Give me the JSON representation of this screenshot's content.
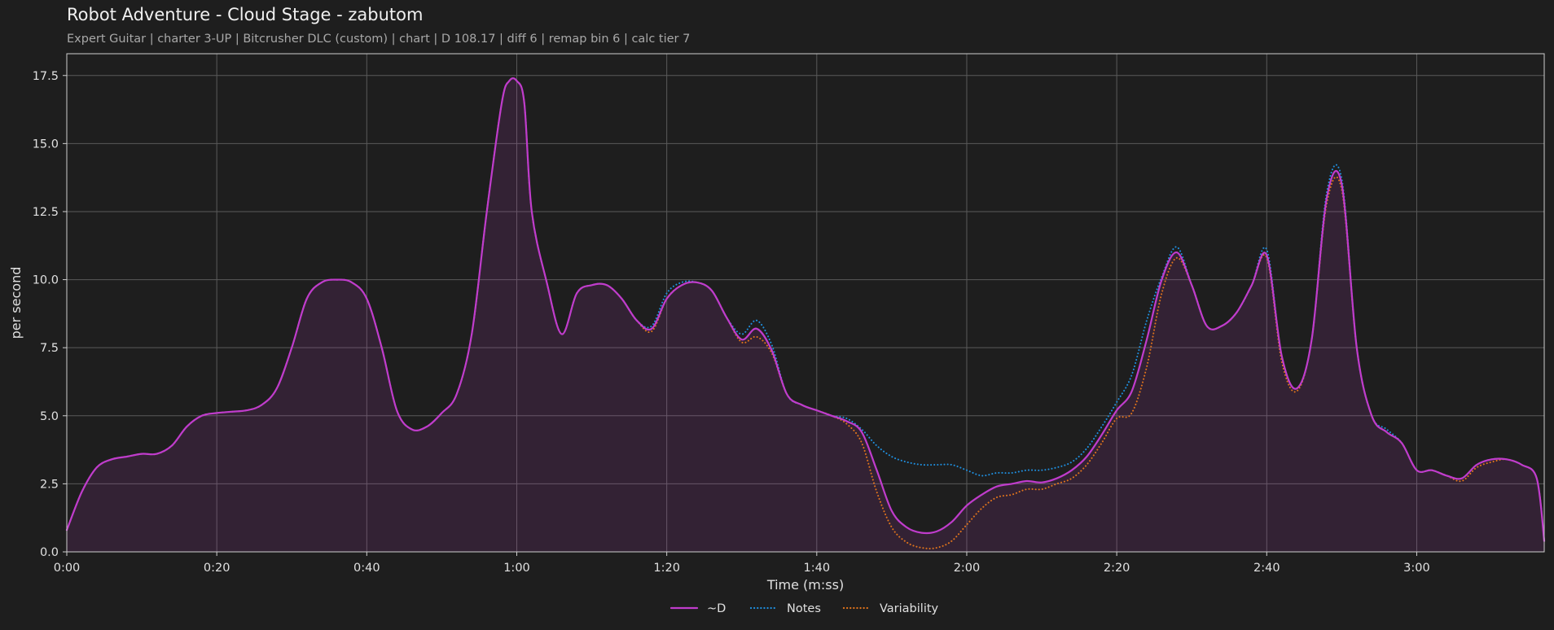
{
  "chart_data": {
    "type": "line",
    "title": "Robot Adventure - Cloud Stage - zabutom",
    "subtitle": "Expert Guitar  |  charter 3-UP  |  Bitcrusher DLC (custom)  |  chart  |  D 108.17  |  diff 6  |  remap bin 6  |  calc tier 7",
    "xlabel": "Time (m:ss)",
    "ylabel": "per second",
    "xlim": [
      0,
      197
    ],
    "ylim": [
      0,
      18.3
    ],
    "xticks": [
      0,
      20,
      40,
      60,
      80,
      100,
      120,
      140,
      160,
      180
    ],
    "xtick_labels": [
      "0:00",
      "0:20",
      "0:40",
      "1:00",
      "1:20",
      "1:40",
      "2:00",
      "2:20",
      "2:40",
      "3:00"
    ],
    "yticks": [
      0,
      2.5,
      5,
      7.5,
      10,
      12.5,
      15,
      17.5
    ],
    "ytick_labels": [
      "0.0",
      "2.5",
      "5.0",
      "7.5",
      "10.0",
      "12.5",
      "15.0",
      "17.5"
    ],
    "grid": true,
    "legend_position": "bottom-center",
    "x": [
      0,
      2,
      4,
      6,
      8,
      10,
      12,
      14,
      16,
      18,
      20,
      22,
      24,
      26,
      28,
      30,
      32,
      34,
      36,
      38,
      40,
      42,
      44,
      46,
      48,
      50,
      52,
      54,
      56,
      58,
      59,
      60,
      61,
      62,
      64,
      66,
      68,
      70,
      72,
      74,
      76,
      78,
      80,
      82,
      84,
      86,
      88,
      90,
      92,
      94,
      96,
      98,
      100,
      102,
      104,
      106,
      108,
      110,
      112,
      114,
      116,
      118,
      120,
      122,
      124,
      126,
      128,
      130,
      132,
      134,
      136,
      138,
      140,
      142,
      144,
      146,
      148,
      150,
      152,
      154,
      156,
      158,
      160,
      162,
      164,
      166,
      168,
      170,
      172,
      174,
      176,
      178,
      180,
      182,
      184,
      186,
      188,
      190,
      192,
      194,
      196,
      197
    ],
    "series": [
      {
        "name": "~D",
        "color": "#c03ccc",
        "style": "solid",
        "values": [
          0.8,
          2.2,
          3.1,
          3.4,
          3.5,
          3.6,
          3.6,
          3.9,
          4.6,
          5.0,
          5.1,
          5.15,
          5.2,
          5.4,
          6.0,
          7.5,
          9.3,
          9.9,
          10.0,
          9.9,
          9.3,
          7.5,
          5.2,
          4.5,
          4.6,
          5.1,
          5.8,
          8.0,
          12.5,
          16.5,
          17.3,
          17.3,
          16.5,
          12.5,
          9.9,
          8.0,
          9.5,
          9.8,
          9.8,
          9.3,
          8.5,
          8.2,
          9.3,
          9.8,
          9.9,
          9.6,
          8.6,
          7.8,
          8.2,
          7.4,
          5.8,
          5.4,
          5.2,
          5.0,
          4.8,
          4.4,
          3.0,
          1.5,
          0.9,
          0.7,
          0.75,
          1.1,
          1.7,
          2.1,
          2.4,
          2.5,
          2.6,
          2.55,
          2.7,
          3.0,
          3.5,
          4.3,
          5.2,
          5.9,
          7.8,
          10.0,
          11.0,
          9.8,
          8.3,
          8.3,
          8.8,
          9.8,
          10.9,
          7.2,
          6.0,
          7.8,
          13.0,
          13.5,
          7.5,
          5.0,
          4.4,
          4.0,
          3.0,
          3.0,
          2.8,
          2.7,
          3.2,
          3.4,
          3.4,
          3.2,
          2.7,
          0.4
        ]
      },
      {
        "name": "Notes",
        "color": "#1f8fdf",
        "style": "dotted",
        "values": [
          0.8,
          2.2,
          3.1,
          3.4,
          3.5,
          3.6,
          3.6,
          3.9,
          4.6,
          5.0,
          5.1,
          5.15,
          5.2,
          5.4,
          6.0,
          7.5,
          9.3,
          9.9,
          10.0,
          9.9,
          9.3,
          7.5,
          5.2,
          4.5,
          4.6,
          5.1,
          5.8,
          8.0,
          12.5,
          16.5,
          17.3,
          17.3,
          16.5,
          12.5,
          9.9,
          8.0,
          9.5,
          9.8,
          9.8,
          9.3,
          8.5,
          8.3,
          9.5,
          9.9,
          9.9,
          9.6,
          8.6,
          8.0,
          8.5,
          7.6,
          5.8,
          5.4,
          5.2,
          5.0,
          4.9,
          4.5,
          3.9,
          3.5,
          3.3,
          3.2,
          3.2,
          3.2,
          3.0,
          2.8,
          2.9,
          2.9,
          3.0,
          3.0,
          3.1,
          3.3,
          3.8,
          4.6,
          5.5,
          6.5,
          8.5,
          10.1,
          11.2,
          9.8,
          8.3,
          8.3,
          8.8,
          9.8,
          11.1,
          7.2,
          6.0,
          7.8,
          13.2,
          13.7,
          7.5,
          5.0,
          4.5,
          4.0,
          3.0,
          3.0,
          2.8,
          2.7,
          3.2,
          3.4,
          3.4,
          3.2,
          2.7,
          0.4
        ]
      },
      {
        "name": "Variability",
        "color": "#e0741c",
        "style": "dotted",
        "values": [
          0.8,
          2.2,
          3.1,
          3.4,
          3.5,
          3.6,
          3.6,
          3.9,
          4.6,
          5.0,
          5.1,
          5.15,
          5.2,
          5.4,
          6.0,
          7.5,
          9.3,
          9.9,
          10.0,
          9.9,
          9.3,
          7.5,
          5.2,
          4.5,
          4.6,
          5.1,
          5.8,
          8.0,
          12.5,
          16.5,
          17.3,
          17.3,
          16.5,
          12.5,
          9.9,
          8.0,
          9.5,
          9.8,
          9.8,
          9.3,
          8.5,
          8.1,
          9.3,
          9.8,
          9.9,
          9.6,
          8.6,
          7.7,
          7.9,
          7.3,
          5.8,
          5.4,
          5.2,
          5.0,
          4.7,
          4.0,
          2.2,
          0.9,
          0.35,
          0.15,
          0.15,
          0.4,
          1.0,
          1.6,
          2.0,
          2.1,
          2.3,
          2.3,
          2.5,
          2.7,
          3.2,
          4.0,
          4.9,
          5.1,
          6.8,
          9.5,
          10.8,
          9.8,
          8.3,
          8.3,
          8.8,
          9.8,
          10.8,
          7.0,
          5.9,
          7.8,
          12.8,
          13.3,
          7.5,
          5.0,
          4.4,
          4.0,
          3.0,
          3.0,
          2.8,
          2.6,
          3.1,
          3.3,
          3.4,
          3.2,
          2.7,
          0.4
        ]
      }
    ]
  }
}
